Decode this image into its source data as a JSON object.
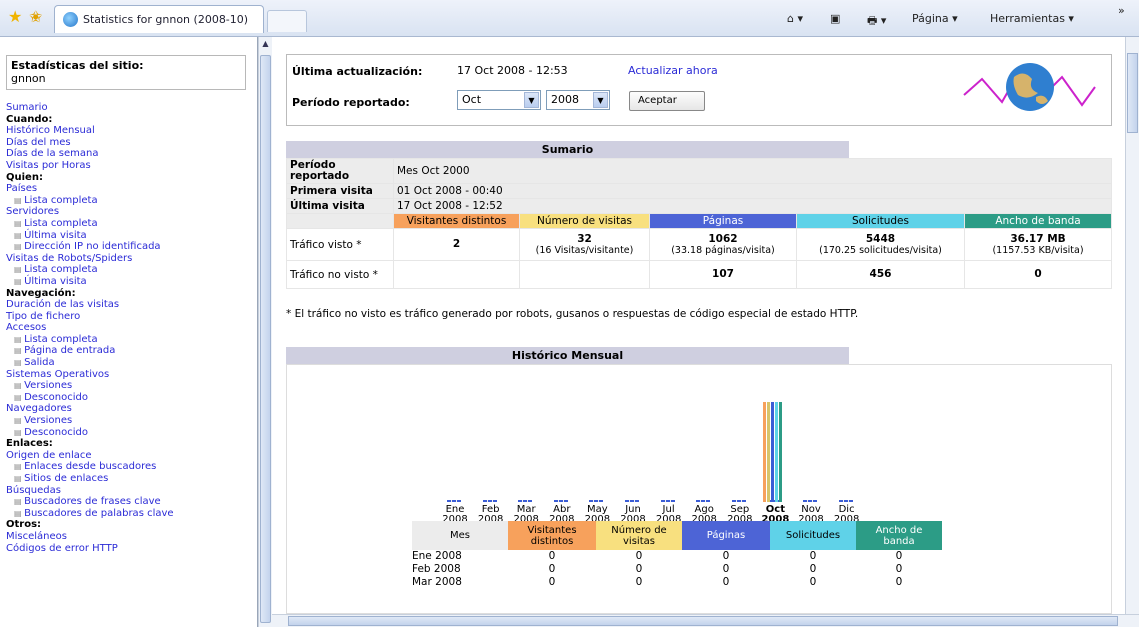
{
  "browser": {
    "tab_title": "Statistics for gnnon (2008-10)",
    "home": "⌂ ▾",
    "feeds": "▣",
    "print": "🖶 ▾",
    "page_menu": "Página ▾",
    "tools_menu": "Herramientas ▾",
    "chevron": "»"
  },
  "sidebar": {
    "title": "Estadísticas del sitio:",
    "site": "gnnon",
    "items": [
      {
        "t": "l",
        "x": "Sumario"
      },
      {
        "t": "h",
        "x": "Cuando:"
      },
      {
        "t": "l",
        "x": "Histórico Mensual"
      },
      {
        "t": "l",
        "x": "Días del mes"
      },
      {
        "t": "l",
        "x": "Días de la semana"
      },
      {
        "t": "l",
        "x": "Visitas por Horas"
      },
      {
        "t": "h",
        "x": "Quien:"
      },
      {
        "t": "l",
        "x": "Países"
      },
      {
        "t": "s",
        "x": "Lista completa"
      },
      {
        "t": "l",
        "x": "Servidores"
      },
      {
        "t": "s",
        "x": "Lista completa"
      },
      {
        "t": "s",
        "x": "Última visita"
      },
      {
        "t": "s",
        "x": "Dirección IP no identificada"
      },
      {
        "t": "l",
        "x": "Visitas de Robots/Spiders"
      },
      {
        "t": "s",
        "x": "Lista completa"
      },
      {
        "t": "s",
        "x": "Última visita"
      },
      {
        "t": "h",
        "x": "Navegación:"
      },
      {
        "t": "l",
        "x": "Duración de las visitas"
      },
      {
        "t": "l",
        "x": "Tipo de fichero"
      },
      {
        "t": "l",
        "x": "Accesos"
      },
      {
        "t": "s",
        "x": "Lista completa"
      },
      {
        "t": "s",
        "x": "Página de entrada"
      },
      {
        "t": "s",
        "x": "Salida"
      },
      {
        "t": "l",
        "x": "Sistemas Operativos"
      },
      {
        "t": "s",
        "x": "Versiones"
      },
      {
        "t": "s",
        "x": "Desconocido"
      },
      {
        "t": "l",
        "x": "Navegadores"
      },
      {
        "t": "s",
        "x": "Versiones"
      },
      {
        "t": "s",
        "x": "Desconocido"
      },
      {
        "t": "h",
        "x": "Enlaces:"
      },
      {
        "t": "l",
        "x": "Origen de enlace"
      },
      {
        "t": "s",
        "x": "Enlaces desde buscadores"
      },
      {
        "t": "s",
        "x": "Sitios de enlaces"
      },
      {
        "t": "l",
        "x": "Búsquedas"
      },
      {
        "t": "s",
        "x": "Buscadores de frases clave"
      },
      {
        "t": "s",
        "x": "Buscadores de palabras clave"
      },
      {
        "t": "h",
        "x": "Otros:"
      },
      {
        "t": "l",
        "x": "Misceláneos"
      },
      {
        "t": "l",
        "x": "Códigos de error HTTP"
      }
    ]
  },
  "header": {
    "last_update_label": "Última actualización:",
    "last_update_value": "17 Oct 2008 - 12:53",
    "update_now": "Actualizar ahora",
    "period_label": "Período reportado:",
    "month": "Oct",
    "year": "2008",
    "accept": "Aceptar"
  },
  "summary": {
    "title": "Sumario",
    "period_label": "Período reportado",
    "period_value": "Mes Oct 2000",
    "first_label": "Primera visita",
    "first_value": "01 Oct 2008 - 00:40",
    "last_label": "Última visita",
    "last_value": "17 Oct 2008 - 12:52",
    "cols": [
      "Visitantes distintos",
      "Número de visitas",
      "Páginas",
      "Solicitudes",
      "Ancho de banda"
    ],
    "seen_label": "Tráfico visto *",
    "seen": [
      "2",
      "32",
      "1062",
      "5448",
      "36.17 MB"
    ],
    "seen_sub": [
      "",
      "(16 Visitas/visitante)",
      "(33.18 páginas/visita)",
      "(170.25 solicitudes/visita)",
      "(1157.53 KB/visita)"
    ],
    "notseen_label": "Tráfico no visto *",
    "notseen": [
      "",
      "",
      "107",
      "456",
      "0"
    ],
    "note": "* El tráfico no visto es tráfico generado por robots, gusanos o respuestas de código especial de estado HTTP."
  },
  "history": {
    "title": "Histórico Mensual",
    "months": [
      {
        "m": "Ene",
        "y": "2008"
      },
      {
        "m": "Feb",
        "y": "2008"
      },
      {
        "m": "Mar",
        "y": "2008"
      },
      {
        "m": "Abr",
        "y": "2008"
      },
      {
        "m": "May",
        "y": "2008"
      },
      {
        "m": "Jun",
        "y": "2008"
      },
      {
        "m": "Jul",
        "y": "2008"
      },
      {
        "m": "Ago",
        "y": "2008"
      },
      {
        "m": "Sep",
        "y": "2008"
      },
      {
        "m": "Oct",
        "y": "2008"
      },
      {
        "m": "Nov",
        "y": "2008"
      },
      {
        "m": "Dic",
        "y": "2008"
      }
    ],
    "cols": [
      "Mes",
      "Visitantes distintos",
      "Número de visitas",
      "Páginas",
      "Solicitudes",
      "Ancho de banda"
    ],
    "rows": [
      [
        "Ene 2008",
        "0",
        "0",
        "0",
        "0",
        "0"
      ],
      [
        "Feb 2008",
        "0",
        "0",
        "0",
        "0",
        "0"
      ],
      [
        "Mar 2008",
        "0",
        "0",
        "0",
        "0",
        "0"
      ]
    ]
  },
  "chart_data": {
    "type": "bar",
    "categories": [
      "Ene 2008",
      "Feb 2008",
      "Mar 2008",
      "Abr 2008",
      "May 2008",
      "Jun 2008",
      "Jul 2008",
      "Ago 2008",
      "Sep 2008",
      "Oct 2008",
      "Nov 2008",
      "Dic 2008"
    ],
    "series": [
      {
        "values": [
          0,
          0,
          0,
          0,
          0,
          0,
          0,
          0,
          0,
          2,
          0,
          0
        ]
      },
      {
        "values": [
          0,
          0,
          0,
          0,
          0,
          0,
          0,
          0,
          0,
          32,
          0,
          0
        ]
      },
      {
        "values": [
          0,
          0,
          0,
          0,
          0,
          0,
          0,
          0,
          0,
          1062,
          0,
          0
        ]
      },
      {
        "values": [
          0,
          0,
          0,
          0,
          0,
          0,
          0,
          0,
          0,
          5448,
          0,
          0
        ]
      },
      {
        "values": [
          0,
          0,
          0,
          0,
          0,
          0,
          0,
          0,
          0,
          36.17,
          0,
          0
        ]
      }
    ],
    "colors": [
      "#f7a15c",
      "#d8c46a",
      "#3b5dd6",
      "#5fd2e8",
      "#2c9c86"
    ]
  }
}
